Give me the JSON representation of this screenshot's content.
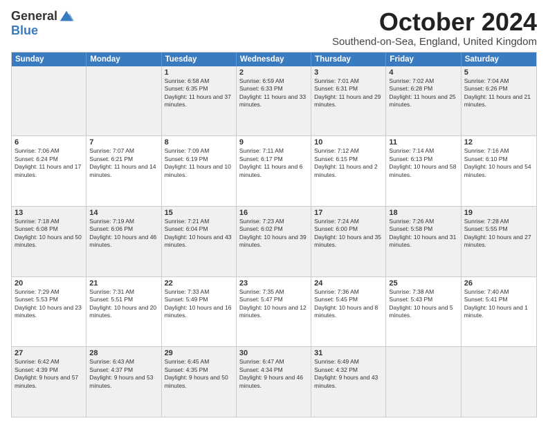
{
  "logo": {
    "general": "General",
    "blue": "Blue"
  },
  "title": "October 2024",
  "subtitle": "Southend-on-Sea, England, United Kingdom",
  "days": [
    "Sunday",
    "Monday",
    "Tuesday",
    "Wednesday",
    "Thursday",
    "Friday",
    "Saturday"
  ],
  "weeks": [
    [
      {
        "day": "",
        "info": ""
      },
      {
        "day": "",
        "info": ""
      },
      {
        "day": "1",
        "info": "Sunrise: 6:58 AM\nSunset: 6:35 PM\nDaylight: 11 hours and 37 minutes."
      },
      {
        "day": "2",
        "info": "Sunrise: 6:59 AM\nSunset: 6:33 PM\nDaylight: 11 hours and 33 minutes."
      },
      {
        "day": "3",
        "info": "Sunrise: 7:01 AM\nSunset: 6:31 PM\nDaylight: 11 hours and 29 minutes."
      },
      {
        "day": "4",
        "info": "Sunrise: 7:02 AM\nSunset: 6:28 PM\nDaylight: 11 hours and 25 minutes."
      },
      {
        "day": "5",
        "info": "Sunrise: 7:04 AM\nSunset: 6:26 PM\nDaylight: 11 hours and 21 minutes."
      }
    ],
    [
      {
        "day": "6",
        "info": "Sunrise: 7:06 AM\nSunset: 6:24 PM\nDaylight: 11 hours and 17 minutes."
      },
      {
        "day": "7",
        "info": "Sunrise: 7:07 AM\nSunset: 6:21 PM\nDaylight: 11 hours and 14 minutes."
      },
      {
        "day": "8",
        "info": "Sunrise: 7:09 AM\nSunset: 6:19 PM\nDaylight: 11 hours and 10 minutes."
      },
      {
        "day": "9",
        "info": "Sunrise: 7:11 AM\nSunset: 6:17 PM\nDaylight: 11 hours and 6 minutes."
      },
      {
        "day": "10",
        "info": "Sunrise: 7:12 AM\nSunset: 6:15 PM\nDaylight: 11 hours and 2 minutes."
      },
      {
        "day": "11",
        "info": "Sunrise: 7:14 AM\nSunset: 6:13 PM\nDaylight: 10 hours and 58 minutes."
      },
      {
        "day": "12",
        "info": "Sunrise: 7:16 AM\nSunset: 6:10 PM\nDaylight: 10 hours and 54 minutes."
      }
    ],
    [
      {
        "day": "13",
        "info": "Sunrise: 7:18 AM\nSunset: 6:08 PM\nDaylight: 10 hours and 50 minutes."
      },
      {
        "day": "14",
        "info": "Sunrise: 7:19 AM\nSunset: 6:06 PM\nDaylight: 10 hours and 46 minutes."
      },
      {
        "day": "15",
        "info": "Sunrise: 7:21 AM\nSunset: 6:04 PM\nDaylight: 10 hours and 43 minutes."
      },
      {
        "day": "16",
        "info": "Sunrise: 7:23 AM\nSunset: 6:02 PM\nDaylight: 10 hours and 39 minutes."
      },
      {
        "day": "17",
        "info": "Sunrise: 7:24 AM\nSunset: 6:00 PM\nDaylight: 10 hours and 35 minutes."
      },
      {
        "day": "18",
        "info": "Sunrise: 7:26 AM\nSunset: 5:58 PM\nDaylight: 10 hours and 31 minutes."
      },
      {
        "day": "19",
        "info": "Sunrise: 7:28 AM\nSunset: 5:55 PM\nDaylight: 10 hours and 27 minutes."
      }
    ],
    [
      {
        "day": "20",
        "info": "Sunrise: 7:29 AM\nSunset: 5:53 PM\nDaylight: 10 hours and 23 minutes."
      },
      {
        "day": "21",
        "info": "Sunrise: 7:31 AM\nSunset: 5:51 PM\nDaylight: 10 hours and 20 minutes."
      },
      {
        "day": "22",
        "info": "Sunrise: 7:33 AM\nSunset: 5:49 PM\nDaylight: 10 hours and 16 minutes."
      },
      {
        "day": "23",
        "info": "Sunrise: 7:35 AM\nSunset: 5:47 PM\nDaylight: 10 hours and 12 minutes."
      },
      {
        "day": "24",
        "info": "Sunrise: 7:36 AM\nSunset: 5:45 PM\nDaylight: 10 hours and 8 minutes."
      },
      {
        "day": "25",
        "info": "Sunrise: 7:38 AM\nSunset: 5:43 PM\nDaylight: 10 hours and 5 minutes."
      },
      {
        "day": "26",
        "info": "Sunrise: 7:40 AM\nSunset: 5:41 PM\nDaylight: 10 hours and 1 minute."
      }
    ],
    [
      {
        "day": "27",
        "info": "Sunrise: 6:42 AM\nSunset: 4:39 PM\nDaylight: 9 hours and 57 minutes."
      },
      {
        "day": "28",
        "info": "Sunrise: 6:43 AM\nSunset: 4:37 PM\nDaylight: 9 hours and 53 minutes."
      },
      {
        "day": "29",
        "info": "Sunrise: 6:45 AM\nSunset: 4:35 PM\nDaylight: 9 hours and 50 minutes."
      },
      {
        "day": "30",
        "info": "Sunrise: 6:47 AM\nSunset: 4:34 PM\nDaylight: 9 hours and 46 minutes."
      },
      {
        "day": "31",
        "info": "Sunrise: 6:49 AM\nSunset: 4:32 PM\nDaylight: 9 hours and 43 minutes."
      },
      {
        "day": "",
        "info": ""
      },
      {
        "day": "",
        "info": ""
      }
    ]
  ]
}
